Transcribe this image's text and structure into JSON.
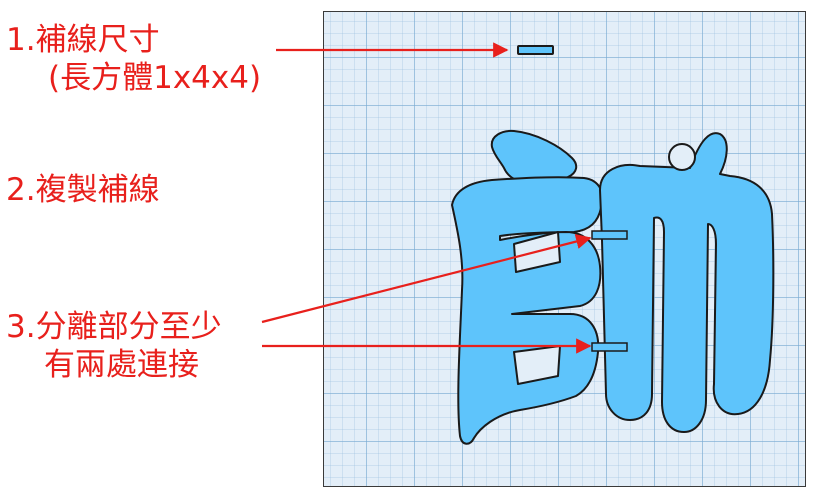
{
  "annotations": {
    "step1": {
      "line1": "1.補線尺寸",
      "line2": "(長方體1x4x4)"
    },
    "step2": {
      "line1": "2.複製補線"
    },
    "step3": {
      "line1": "3.分離部分至少",
      "line2": "有兩處連接"
    }
  },
  "colors": {
    "annotation": "#e8201c",
    "character_fill": "#5ec4fb",
    "patch_fill": "#5ec4fb",
    "grid_background": "#e3eef8"
  },
  "icons": {
    "character": "shuai-character-3d-model",
    "patch": "rectangular-patch-bar"
  }
}
